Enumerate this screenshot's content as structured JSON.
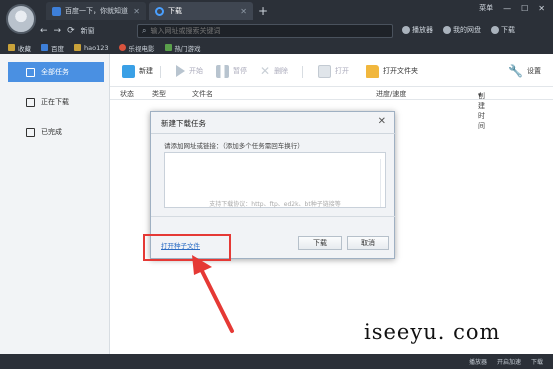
{
  "tabs": [
    {
      "label": "百度一下，你就知道",
      "active": false
    },
    {
      "label": "下载",
      "active": true
    }
  ],
  "window_controls": {
    "menu_label": "菜单"
  },
  "nav": {
    "dropdown_label": "新窗",
    "address_placeholder": "输入网址或搜索关键词"
  },
  "right_nav": [
    "播放器",
    "我的网盘",
    "下载"
  ],
  "bookmarks": [
    "收藏",
    "百度",
    "hao123",
    "乐视电影",
    "热门游戏"
  ],
  "sidebar": {
    "items": [
      {
        "label": "全部任务",
        "active": true
      },
      {
        "label": "正在下载",
        "active": false
      },
      {
        "label": "已完成",
        "active": false
      }
    ]
  },
  "toolbar": {
    "new": "新建",
    "start": "开始",
    "pause": "暂停",
    "delete": "删除",
    "open": "打开",
    "open_folder": "打开文件夹",
    "settings": "设置"
  },
  "columns": [
    "状态",
    "类型",
    "文件名",
    "进度/速度",
    "创建时间"
  ],
  "dialog": {
    "title": "新建下载任务",
    "hint": "请添加网址或链接：（添加多个任务需回车换行）",
    "textarea_placeholder": "支持下载协议：http、ftp、ed2k、bt种子链接等",
    "link": "打开种子文件",
    "download_button": "下载",
    "cancel_button": "取消"
  },
  "watermark": "iseeyu. com",
  "status_bar": [
    "播放器",
    "开启加速",
    "下载"
  ],
  "colors": {
    "accent": "#4a90e2",
    "highlight": "#e53935",
    "chrome": "#2b3038"
  }
}
